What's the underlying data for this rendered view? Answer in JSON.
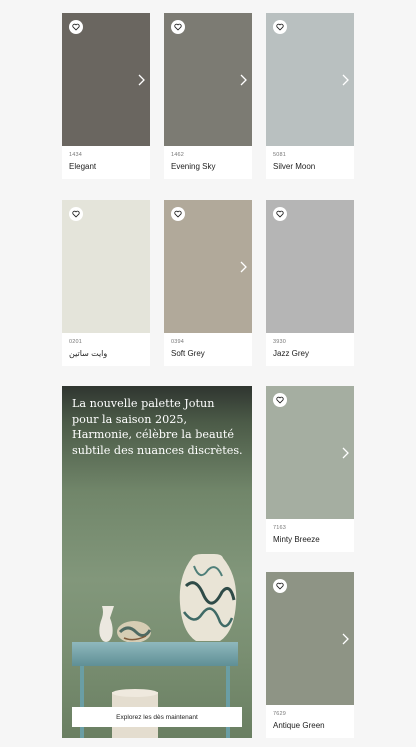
{
  "cards": [
    {
      "code": "1434",
      "name": "Elegant",
      "color": "#6a6660",
      "arrow": true
    },
    {
      "code": "1462",
      "name": "Evening Sky",
      "color": "#7c7b73",
      "arrow": true
    },
    {
      "code": "5081",
      "name": "Silver Moon",
      "color": "#b9c0c0",
      "arrow": true
    },
    {
      "code": "0201",
      "name": "وايت ساتين",
      "color": "#e4e4da",
      "arrow": false
    },
    {
      "code": "0394",
      "name": "Soft Grey",
      "color": "#b1a99a",
      "arrow": true
    },
    {
      "code": "3930",
      "name": "Jazz Grey",
      "color": "#b5b5b5",
      "arrow": false
    },
    {
      "code": "7163",
      "name": "Minty Breeze",
      "color": "#a5aea1",
      "arrow": true
    },
    {
      "code": "7629",
      "name": "Antique Green",
      "color": "#8e9485",
      "arrow": true
    }
  ],
  "promo": {
    "text": "La nouvelle palette Jotun pour la saison 2025, Harmonie, célèbre la beauté subtile des nuances discrètes.",
    "cta_label": "Explorez les dès maintenant"
  },
  "icons": {
    "favorite": "heart-outline-icon",
    "next": "chevron-right-icon"
  }
}
